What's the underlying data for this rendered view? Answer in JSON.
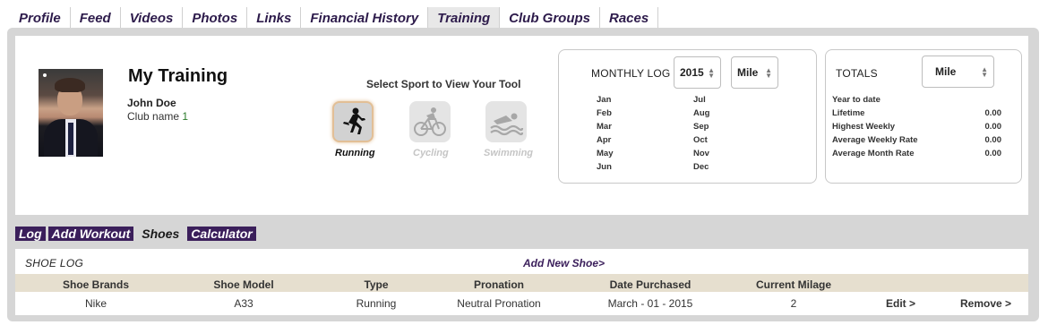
{
  "nav": {
    "tabs": [
      "Profile",
      "Feed",
      "Videos",
      "Photos",
      "Links",
      "Financial History",
      "Training",
      "Club Groups",
      "Races"
    ],
    "active_tab": "Training"
  },
  "profile": {
    "title": "My Training",
    "name": "John Doe",
    "club_label": "Club name ",
    "club_number": "1"
  },
  "sport_selector": {
    "title": "Select Sport to View Your Tool",
    "sports": [
      {
        "label": "Running",
        "icon": "running-icon",
        "active": true
      },
      {
        "label": "Cycling",
        "icon": "cycling-icon",
        "active": false
      },
      {
        "label": "Swimming",
        "icon": "swimming-icon",
        "active": false
      }
    ]
  },
  "monthly_log": {
    "title": "MONTHLY LOG",
    "year": "2015",
    "unit": "Mile",
    "months_left": [
      "Jan",
      "Feb",
      "Mar",
      "Apr",
      "May",
      "Jun"
    ],
    "months_right": [
      "Jul",
      "Aug",
      "Sep",
      "Oct",
      "Nov",
      "Dec"
    ]
  },
  "totals": {
    "title": "TOTALS",
    "unit": "Mile",
    "rows": [
      {
        "label": "Year to date",
        "value": ""
      },
      {
        "label": "Lifetime",
        "value": "0.00"
      },
      {
        "label": "Highest Weekly",
        "value": "0.00"
      },
      {
        "label": "Average Weekly Rate",
        "value": "0.00"
      },
      {
        "label": "Average Month Rate",
        "value": "0.00"
      }
    ]
  },
  "subtabs": {
    "items": [
      "Log",
      "Add Workout",
      "Shoes",
      "Calculator"
    ],
    "active": "Shoes"
  },
  "shoe_log": {
    "title": "SHOE LOG",
    "add_link": "Add New Shoe>",
    "columns": [
      "Shoe Brands",
      "Shoe Model",
      "Type",
      "Pronation",
      "Date Purchased",
      "Current Milage"
    ],
    "rows": [
      {
        "brand": "Nike",
        "model": "A33",
        "type": "Running",
        "pronation": "Neutral Pronation",
        "date": "March - 01 - 2015",
        "milage": "2",
        "edit": "Edit >",
        "remove": "Remove >"
      }
    ]
  },
  "colors": {
    "brand_purple": "#3b1f5b",
    "frame_gray": "#d6d6d6",
    "table_header": "#e6dfcf",
    "running_highlight": "#e2bf96"
  }
}
